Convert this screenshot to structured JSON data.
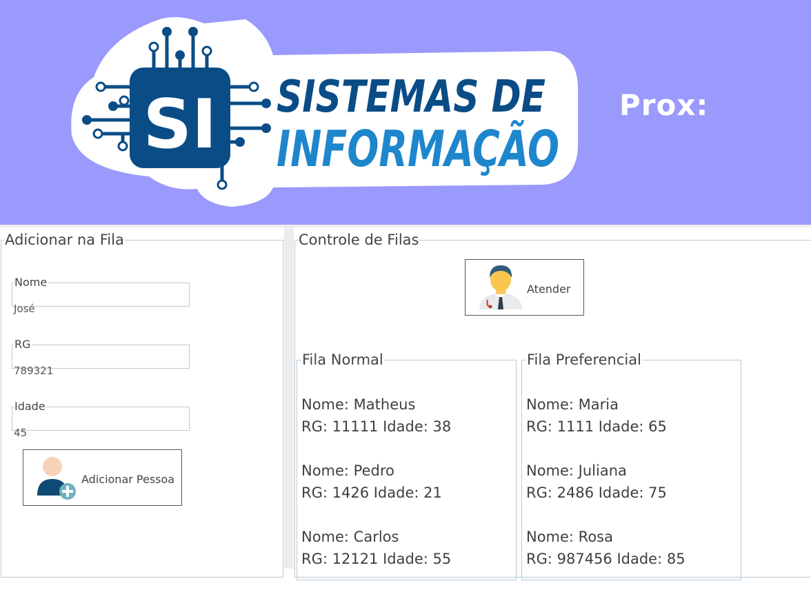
{
  "header": {
    "logo_initials": "SI",
    "logo_line1": "SISTEMAS DE",
    "logo_line2": "INFORMAÇÃO",
    "prox_label": "Prox:",
    "bg_color": "#9a9afd"
  },
  "add_panel": {
    "title": "Adicionar na Fila",
    "nome_label": "Nome",
    "nome_value": "José",
    "rg_label": "RG",
    "rg_value": "789321",
    "idade_label": "Idade",
    "idade_value": "45",
    "add_button_label": "Adicionar Pessoa",
    "add_button_icon": "add-person-icon"
  },
  "control_panel": {
    "title": "Controle de Filas",
    "atender_label": "Atender",
    "atender_icon": "doctor-icon",
    "normal_queue": {
      "title": "Fila Normal",
      "entries": [
        {
          "nome": "Nome: Matheus",
          "info": "RG: 11111 Idade: 38"
        },
        {
          "nome": "Nome: Pedro",
          "info": "RG: 1426 Idade: 21"
        },
        {
          "nome": "Nome: Carlos",
          "info": "RG: 12121 Idade: 55"
        }
      ]
    },
    "preferential_queue": {
      "title": "Fila Preferencial",
      "entries": [
        {
          "nome": "Nome: Maria",
          "info": "RG: 1111 Idade: 65"
        },
        {
          "nome": "Nome: Juliana",
          "info": "RG: 2486 Idade: 75"
        },
        {
          "nome": "Nome: Rosa",
          "info": "RG: 987456 Idade: 85"
        }
      ]
    }
  }
}
